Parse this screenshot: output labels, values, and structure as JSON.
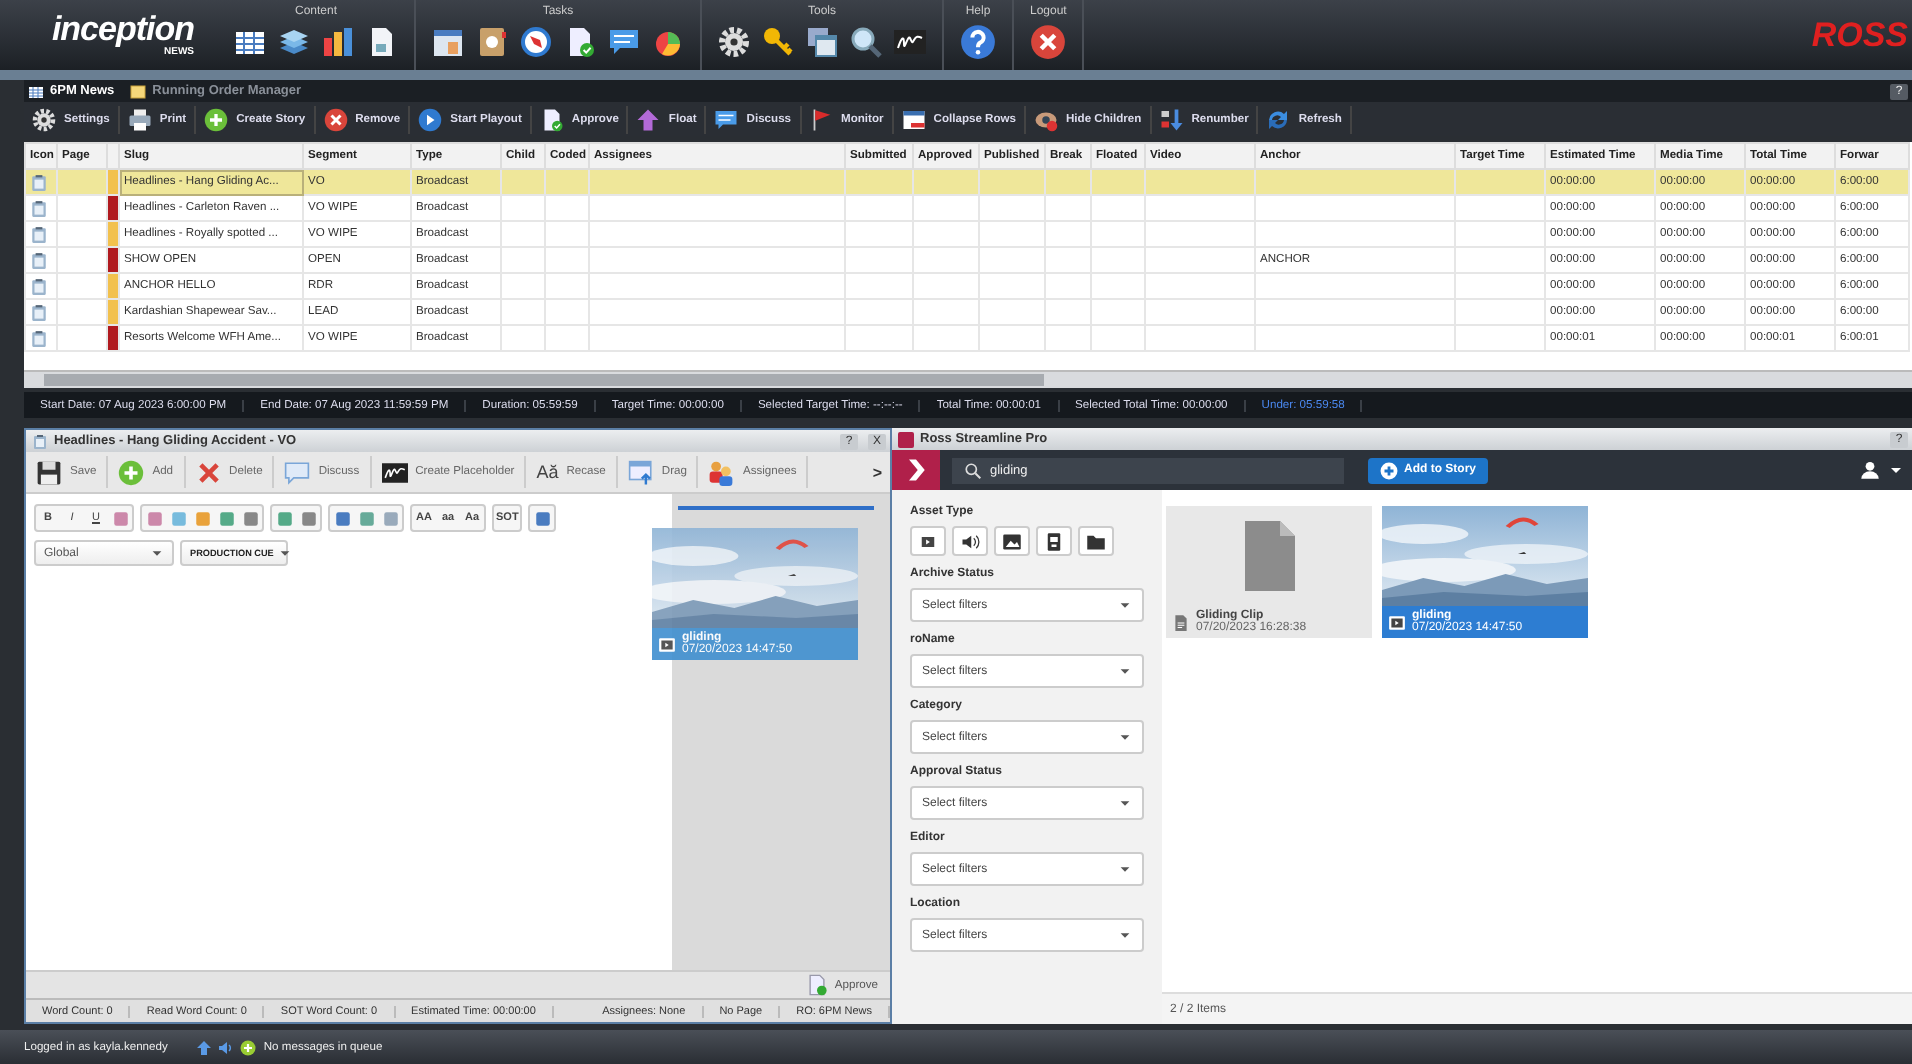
{
  "header": {
    "logo": "inception",
    "logo_sub": "NEWS",
    "groups": [
      {
        "label": "Content"
      },
      {
        "label": "Tasks"
      },
      {
        "label": "Tools"
      },
      {
        "label": "Help"
      },
      {
        "label": "Logout"
      }
    ],
    "brand": "ROSS"
  },
  "tabs": [
    {
      "label": "6PM News",
      "selected": true
    },
    {
      "label": "Running Order Manager",
      "selected": false
    }
  ],
  "tab_controls": [
    "?"
  ],
  "toolbar": [
    "Settings",
    "Print",
    "Create Story",
    "Remove",
    "Start Playout",
    "Approve",
    "Float",
    "Discuss",
    "Monitor",
    "Collapse Rows",
    "Hide Children",
    "Renumber",
    "Refresh"
  ],
  "table": {
    "columns": [
      "Icon",
      "Page",
      "Slug",
      "Segment",
      "Type",
      "Child",
      "Coded",
      "Assignees",
      "Submitted",
      "Approved",
      "Published",
      "Break",
      "Floated",
      "Video",
      "Anchor",
      "Target Time",
      "Estimated Time",
      "Media Time",
      "Total Time",
      "Forwar"
    ],
    "rows": [
      {
        "slug": "Headlines - Hang Gliding Ac...",
        "segment": "VO",
        "type": "Broadcast",
        "estimated_time": "00:00:00",
        "media_time": "00:00:00",
        "total_time": "00:00:00",
        "forward": "6:00:00",
        "color": "#f2c14e",
        "selected": true
      },
      {
        "slug": "Headlines - Carleton Raven ...",
        "segment": "VO WIPE",
        "type": "Broadcast",
        "estimated_time": "00:00:00",
        "media_time": "00:00:00",
        "total_time": "00:00:00",
        "forward": "6:00:00",
        "color": "#b0191e",
        "selected": false
      },
      {
        "slug": "Headlines - Royally spotted ...",
        "segment": "VO WIPE",
        "type": "Broadcast",
        "estimated_time": "00:00:00",
        "media_time": "00:00:00",
        "total_time": "00:00:00",
        "forward": "6:00:00",
        "color": "#f2c14e",
        "selected": false
      },
      {
        "slug": "SHOW OPEN",
        "segment": "OPEN",
        "type": "Broadcast",
        "anchor": "ANCHOR",
        "estimated_time": "00:00:00",
        "media_time": "00:00:00",
        "total_time": "00:00:00",
        "forward": "6:00:00",
        "color": "#b0191e",
        "selected": false
      },
      {
        "slug": "ANCHOR HELLO",
        "segment": "RDR",
        "type": "Broadcast",
        "estimated_time": "00:00:00",
        "media_time": "00:00:00",
        "total_time": "00:00:00",
        "forward": "6:00:00",
        "color": "#f2c14e",
        "selected": false
      },
      {
        "slug": "Kardashian Shapewear Sav...",
        "segment": "LEAD",
        "type": "Broadcast",
        "estimated_time": "00:00:00",
        "media_time": "00:00:00",
        "total_time": "00:00:00",
        "forward": "6:00:00",
        "color": "#f2c14e",
        "selected": false
      },
      {
        "slug": "Resorts Welcome WFH Ame...",
        "segment": "VO WIPE",
        "type": "Broadcast",
        "estimated_time": "00:00:01",
        "media_time": "00:00:00",
        "total_time": "00:00:01",
        "forward": "6:00:01",
        "color": "#b0191e",
        "selected": false
      }
    ]
  },
  "status_bar": [
    {
      "text": "Start Date: 07 Aug 2023 6:00:00 PM",
      "kind": "normal"
    },
    {
      "text": "End Date: 07 Aug 2023 11:59:59 PM",
      "kind": "normal"
    },
    {
      "text": "Duration: 05:59:59",
      "kind": "normal"
    },
    {
      "text": "Target Time: 00:00:00",
      "kind": "normal"
    },
    {
      "text": "Selected Target Time: --:--:--",
      "kind": "normal"
    },
    {
      "text": "Total Time: 00:00:01",
      "kind": "normal"
    },
    {
      "text": "Selected Total Time: 00:00:00",
      "kind": "normal"
    },
    {
      "text": "Under: 05:59:58",
      "kind": "highlight"
    }
  ],
  "story_editor": {
    "title": "Headlines - Hang Gliding Accident - VO",
    "controls": [
      "?",
      "X"
    ],
    "toolbar": [
      {
        "label": "Save"
      },
      {
        "label": "Add"
      },
      {
        "label": "Delete"
      },
      {
        "label": "Discuss"
      },
      {
        "label": "Create Placeholder"
      },
      {
        "label": "Recase",
        "glyph": "Aă"
      },
      {
        "label": "Drag"
      },
      {
        "label": "Assignees"
      }
    ],
    "more": ">",
    "format_toolbar": [
      [
        {
          "kind": "text",
          "label": "B"
        },
        {
          "kind": "text",
          "label": "I"
        },
        {
          "kind": "text",
          "label": "U"
        },
        {
          "kind": "icon"
        }
      ],
      [
        {
          "kind": "icon"
        },
        {
          "kind": "icon"
        },
        {
          "kind": "icon"
        },
        {
          "kind": "icon"
        },
        {
          "kind": "icon"
        }
      ],
      [
        {
          "kind": "icon"
        },
        {
          "kind": "icon"
        }
      ],
      [
        {
          "kind": "icon"
        },
        {
          "kind": "icon"
        },
        {
          "kind": "icon"
        }
      ],
      [
        {
          "kind": "text",
          "label": "AA"
        },
        {
          "kind": "text",
          "label": "aa"
        },
        {
          "kind": "text",
          "label": "Aa"
        }
      ],
      [
        {
          "kind": "text",
          "label": "SOT"
        }
      ],
      [
        {
          "kind": "icon"
        }
      ]
    ],
    "dropdowns": [
      {
        "value": "Global"
      },
      {
        "value": "PRODUCTION CUE"
      }
    ],
    "drag_item": {
      "title": "gliding",
      "date": "07/20/2023 14:47:50"
    },
    "approve": "Approve",
    "status": [
      "Word Count: 0",
      "Read Word Count: 0",
      "SOT Word Count: 0",
      "Estimated Time: 00:00:00",
      "Assignees: None",
      "No Page",
      "RO: 6PM News"
    ]
  },
  "streamline": {
    "title": "Ross Streamline Pro",
    "controls": [
      "?"
    ],
    "search": {
      "value": "gliding"
    },
    "add_button": "Add to Story",
    "asset_type_label": "Asset Type",
    "filters": [
      {
        "label": "Archive Status",
        "placeholder": "Select filters"
      },
      {
        "label": "roName",
        "placeholder": "Select filters"
      },
      {
        "label": "Category",
        "placeholder": "Select filters"
      },
      {
        "label": "Approval Status",
        "placeholder": "Select filters"
      },
      {
        "label": "Editor",
        "placeholder": "Select filters"
      },
      {
        "label": "Location",
        "placeholder": "Select filters"
      }
    ],
    "results": [
      {
        "title": "Gliding Clip",
        "date": "07/20/2023 16:28:38",
        "kind": "document",
        "selected": false
      },
      {
        "title": "gliding",
        "date": "07/20/2023 14:47:50",
        "kind": "picture",
        "selected": true
      }
    ],
    "count": "2 / 2 Items"
  },
  "bottom_bar": {
    "login": "Logged in as kayla.kennedy",
    "message": "No messages in queue"
  }
}
